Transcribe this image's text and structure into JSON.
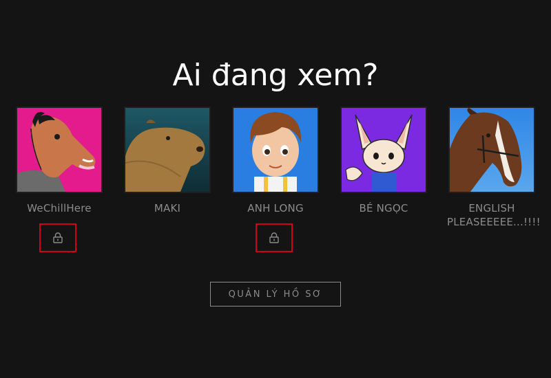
{
  "page": {
    "title": "Ai đang xem?",
    "background": "#141414"
  },
  "profiles": [
    {
      "name": "WeChillHere",
      "avatar_icon": "horse-cartoon-avatar",
      "locked": true,
      "avatar_bg": "#e31b8d"
    },
    {
      "name": "MAKI",
      "avatar_icon": "capybara-avatar",
      "locked": false,
      "avatar_bg": "#1d4f5a"
    },
    {
      "name": "ANH LONG",
      "avatar_icon": "boy-cartoon-avatar",
      "locked": true,
      "avatar_bg": "#2a7de1"
    },
    {
      "name": "BÉ NGỌC",
      "avatar_icon": "fox-cartoon-avatar",
      "locked": false,
      "avatar_bg": "#7b2ae1"
    },
    {
      "name": "ENGLISH PLEASEEEEE...!!!!",
      "avatar_icon": "horse-photo-avatar",
      "locked": false,
      "avatar_bg": "#2a7de1"
    }
  ],
  "lock_icon": "lock-icon",
  "highlight_color": "#d0021b",
  "manage_button": {
    "label": "QUẢN LÝ HỒ SƠ"
  }
}
